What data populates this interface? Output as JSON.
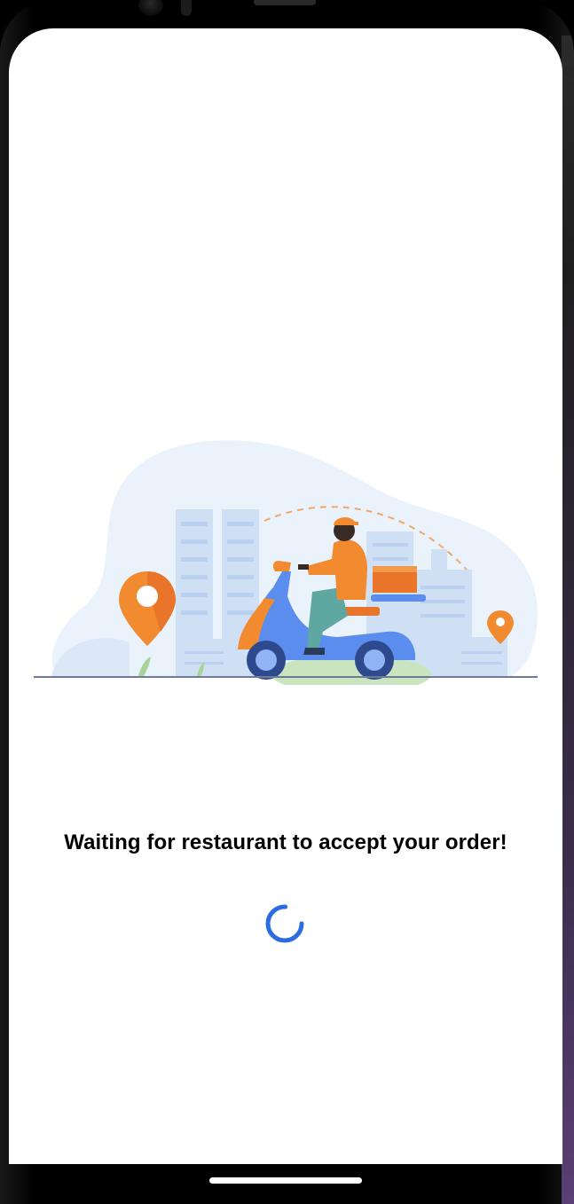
{
  "screen": {
    "status_message": "Waiting for restaurant to accept your order!"
  },
  "icons": {
    "loading": "loading-spinner-icon",
    "illustration": "delivery-scooter-illustration"
  },
  "colors": {
    "spinner": "#2B6CE4",
    "accent_orange": "#F28A30",
    "scooter_blue": "#5B8DEF",
    "background_blob": "#EAF2FC"
  }
}
